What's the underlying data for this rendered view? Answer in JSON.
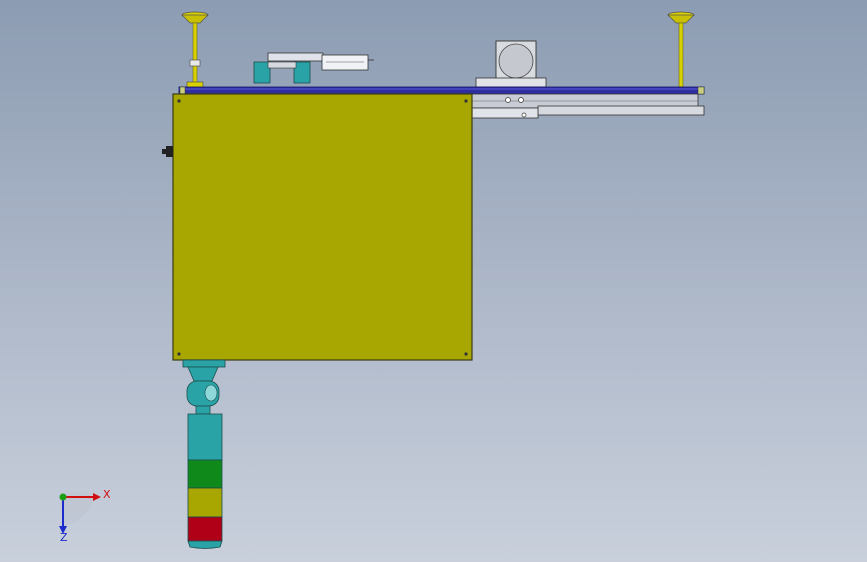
{
  "viewport": {
    "description_label": "",
    "colors": {
      "panel_fill": "#a8a600",
      "panel_edge": "#3c3c10",
      "rail_blue": "#2e2ea0",
      "rail_light": "#5b5bd8",
      "teal": "#2aa3a6",
      "tower_green": "#0f8a1a",
      "tower_yellow": "#a8a600",
      "tower_red": "#b00018",
      "post_yellow": "#d8d000",
      "metal_grey": "#c8ccd4"
    },
    "icons": [
      "triad-axis-icon"
    ]
  },
  "triad": {
    "x_label": "X",
    "z_label": "Z"
  }
}
